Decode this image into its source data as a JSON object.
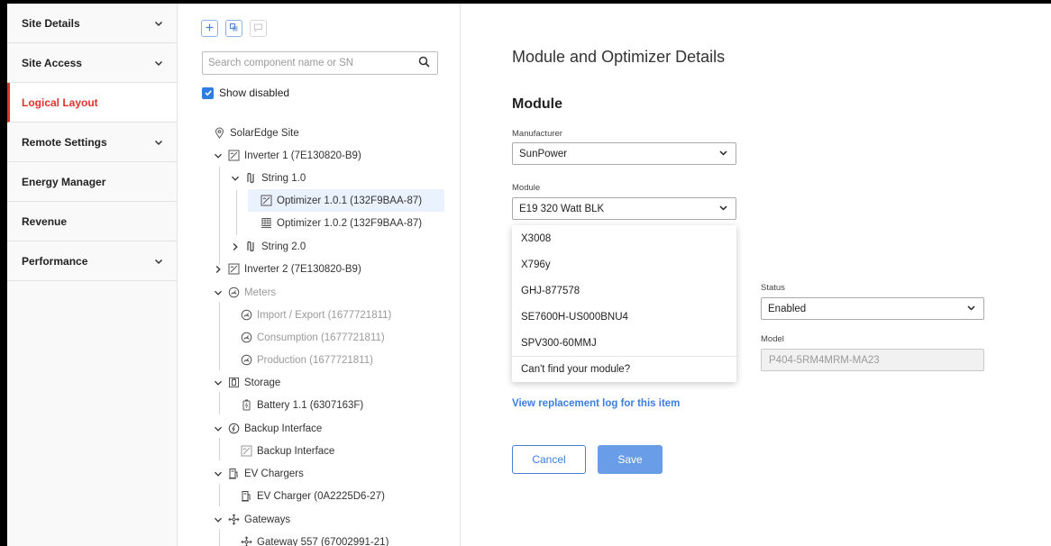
{
  "sidebar": {
    "items": [
      {
        "label": "Site Details",
        "expandable": true
      },
      {
        "label": "Site Access",
        "expandable": true
      },
      {
        "label": "Logical Layout",
        "expandable": false,
        "active": true
      },
      {
        "label": "Remote Settings",
        "expandable": true
      },
      {
        "label": "Energy Manager",
        "expandable": false
      },
      {
        "label": "Revenue",
        "expandable": false
      },
      {
        "label": "Performance",
        "expandable": true
      }
    ],
    "accent_color": "#e1322c"
  },
  "tree_panel": {
    "search_placeholder": "Search component name or SN",
    "show_disabled_label": "Show disabled",
    "show_disabled_checked": true,
    "nodes": [
      {
        "label": "SolarEdge Site"
      },
      {
        "label": "Inverter 1 (7E130820-B9)"
      },
      {
        "label": "String 1.0"
      },
      {
        "label": "Optimizer  1.0.1 (132F9BAA-87)"
      },
      {
        "label": "Optimizer  1.0.2 (132F9BAA-87)"
      },
      {
        "label": "String 2.0"
      },
      {
        "label": "Inverter 2 (7E130820-B9)"
      },
      {
        "label": "Meters"
      },
      {
        "label": "Import / Export (1677721811)"
      },
      {
        "label": "Consumption (1677721811)"
      },
      {
        "label": "Production (1677721811)"
      },
      {
        "label": "Storage"
      },
      {
        "label": "Battery 1.1 (6307163F)"
      },
      {
        "label": "Backup Interface"
      },
      {
        "label": "Backup Interface"
      },
      {
        "label": "EV Chargers"
      },
      {
        "label": "EV Charger (0A2225D6-27)"
      },
      {
        "label": "Gateways"
      },
      {
        "label": "Gateway 557 (67002991-21)"
      }
    ]
  },
  "main": {
    "page_title": "Module and Optimizer Details",
    "section_title": "Module",
    "manufacturer": {
      "label": "Manufacturer",
      "value": "SunPower"
    },
    "module": {
      "label": "Module",
      "value": "E19 320 Watt BLK",
      "options": [
        "X3008",
        "X796y",
        "GHJ-877578",
        "SE7600H-US000BNU4",
        "SPV300-60MMJ"
      ],
      "footer": "Can't find your module?"
    },
    "status": {
      "label": "Status",
      "value": "Enabled"
    },
    "model": {
      "label": "Model",
      "value": "P404-5RM4MRM-MA23"
    },
    "replacement_link": "View replacement log for this item",
    "cancel_label": "Cancel",
    "save_label": "Save",
    "link_color": "#3c7ee0",
    "save_color": "#6a9de8"
  }
}
